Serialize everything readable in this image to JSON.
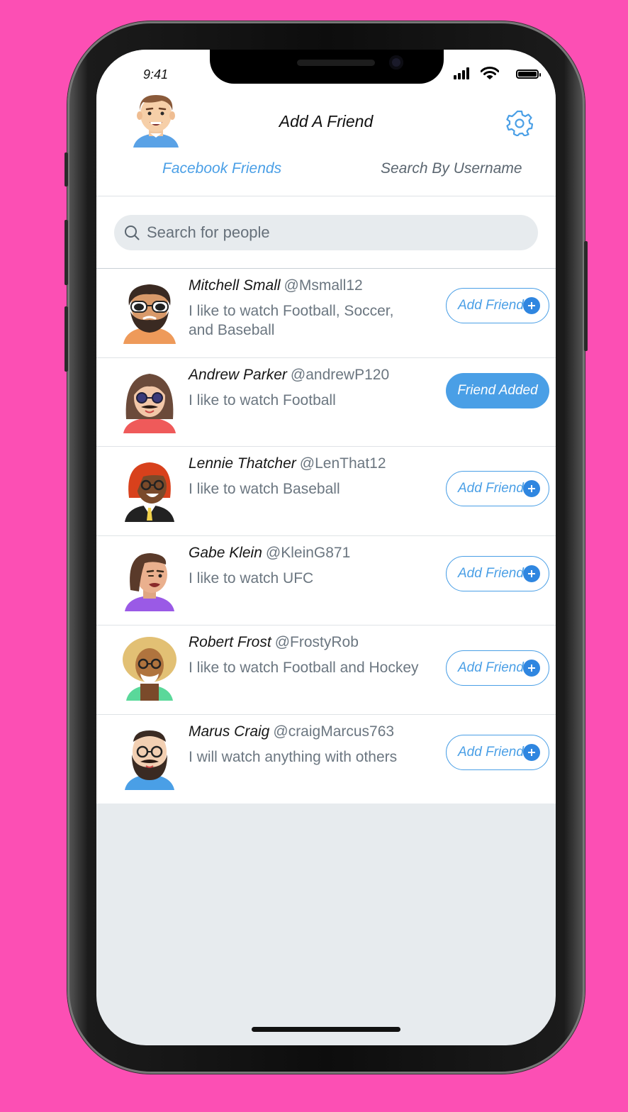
{
  "status_bar": {
    "time": "9:41"
  },
  "header": {
    "title": "Add A Friend",
    "settings_icon": "gear-icon"
  },
  "tabs": [
    {
      "label": "Facebook Friends",
      "active": true
    },
    {
      "label": "Search By Username",
      "active": false
    }
  ],
  "search": {
    "placeholder": "Search for people",
    "icon": "search-icon"
  },
  "colors": {
    "accent": "#4a9fe6",
    "background": "#fc4fb4",
    "plus": "#2f86e0"
  },
  "friends": [
    {
      "name": "Mitchell Small",
      "handle": "@Msmall12",
      "bio": "I like to watch Football, Soccer, and Baseball",
      "action": "Add Friend",
      "added": false
    },
    {
      "name": "Andrew Parker",
      "handle": "@andrewP120",
      "bio": "I like to watch Football",
      "action": "Friend Added",
      "added": true
    },
    {
      "name": "Lennie Thatcher",
      "handle": "@LenThat12",
      "bio": "I like to watch Baseball",
      "action": "Add Friend",
      "added": false
    },
    {
      "name": "Gabe Klein",
      "handle": "@KleinG871",
      "bio": "I like to watch UFC",
      "action": "Add Friend",
      "added": false
    },
    {
      "name": "Robert Frost",
      "handle": "@FrostyRob",
      "bio": "I like to watch Football and Hockey",
      "action": "Add Friend",
      "added": false
    },
    {
      "name": "Marus Craig",
      "handle": "@craigMarcus763",
      "bio": "I will watch anything with others",
      "action": "Add Friend",
      "added": false
    }
  ]
}
